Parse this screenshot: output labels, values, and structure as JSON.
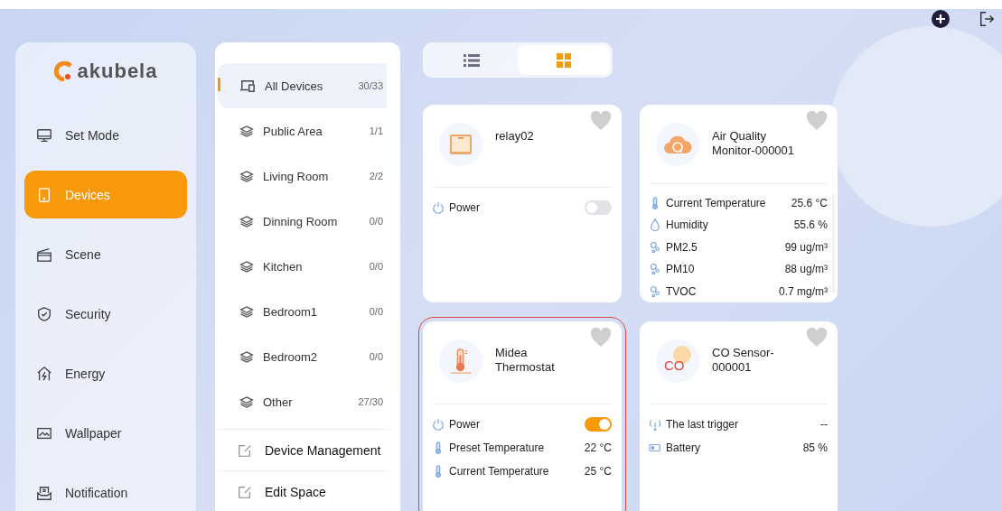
{
  "brand": {
    "logo_text": "akubela"
  },
  "sidebar": {
    "items": [
      {
        "label": "Set Mode",
        "kind": "monitor",
        "selected": false
      },
      {
        "label": "Devices",
        "kind": "tablet",
        "selected": true
      },
      {
        "label": "Scene",
        "kind": "clapper",
        "selected": false
      },
      {
        "label": "Security",
        "kind": "shield",
        "selected": false
      },
      {
        "label": "Energy",
        "kind": "energy",
        "selected": false
      },
      {
        "label": "Wallpaper",
        "kind": "picture",
        "selected": false
      },
      {
        "label": "Notification",
        "kind": "inbox",
        "selected": false
      }
    ]
  },
  "spaces": {
    "items": [
      {
        "label": "All Devices",
        "count": "30/33",
        "kind": "devices",
        "selected": true
      },
      {
        "label": "Public Area",
        "count": "1/1",
        "kind": "layers",
        "selected": false
      },
      {
        "label": "Living Room",
        "count": "2/2",
        "kind": "layers",
        "selected": false
      },
      {
        "label": "Dinning Room",
        "count": "0/0",
        "kind": "layers",
        "selected": false
      },
      {
        "label": "Kitchen",
        "count": "0/0",
        "kind": "layers",
        "selected": false
      },
      {
        "label": "Bedroom1",
        "count": "0/0",
        "kind": "layers",
        "selected": false
      },
      {
        "label": "Bedroom2",
        "count": "0/0",
        "kind": "layers",
        "selected": false
      },
      {
        "label": "Other",
        "count": "27/30",
        "kind": "layers",
        "selected": false
      }
    ],
    "actions": [
      "Device Management",
      "Edit Space"
    ]
  },
  "view_toggle": [
    {
      "kind": "list",
      "selected": false
    },
    {
      "kind": "grid",
      "selected": true
    }
  ],
  "devices": [
    {
      "name": "relay02",
      "kind": "relay",
      "favorite": false,
      "highlighted": false,
      "attributes": [
        {
          "label": "Power",
          "kind": "switch",
          "on": false
        }
      ]
    },
    {
      "name": "Air Quality Monitor-000001",
      "kind": "airmonitor",
      "favorite": false,
      "highlighted": false,
      "attributes": [
        {
          "label": "Current Temperature",
          "kind": "temperature",
          "value": "25.6 °C"
        },
        {
          "label": "Humidity",
          "kind": "humidity",
          "value": "55.6 %"
        },
        {
          "label": "PM2.5",
          "kind": "particles",
          "value": "99 ug/m³"
        },
        {
          "label": "PM10",
          "kind": "particles",
          "value": "88 ug/m³"
        },
        {
          "label": "TVOC",
          "kind": "particles",
          "value": "0.7 mg/m³"
        }
      ]
    },
    {
      "name": "Midea Thermostat",
      "kind": "thermostat",
      "favorite": false,
      "highlighted": true,
      "attributes": [
        {
          "label": "Power",
          "kind": "switch",
          "on": true
        },
        {
          "label": "Preset Temperature",
          "kind": "temperature",
          "value": "22 °C"
        },
        {
          "label": "Current Temperature",
          "kind": "temperature",
          "value": "25 °C"
        }
      ]
    },
    {
      "name": "CO Sensor-000001",
      "kind": "cosensor",
      "badge": "CO",
      "favorite": false,
      "highlighted": false,
      "attributes": [
        {
          "label": "The last trigger",
          "kind": "trigger",
          "value": "--"
        },
        {
          "label": "Battery",
          "kind": "battery",
          "value": "85 %"
        }
      ]
    }
  ]
}
